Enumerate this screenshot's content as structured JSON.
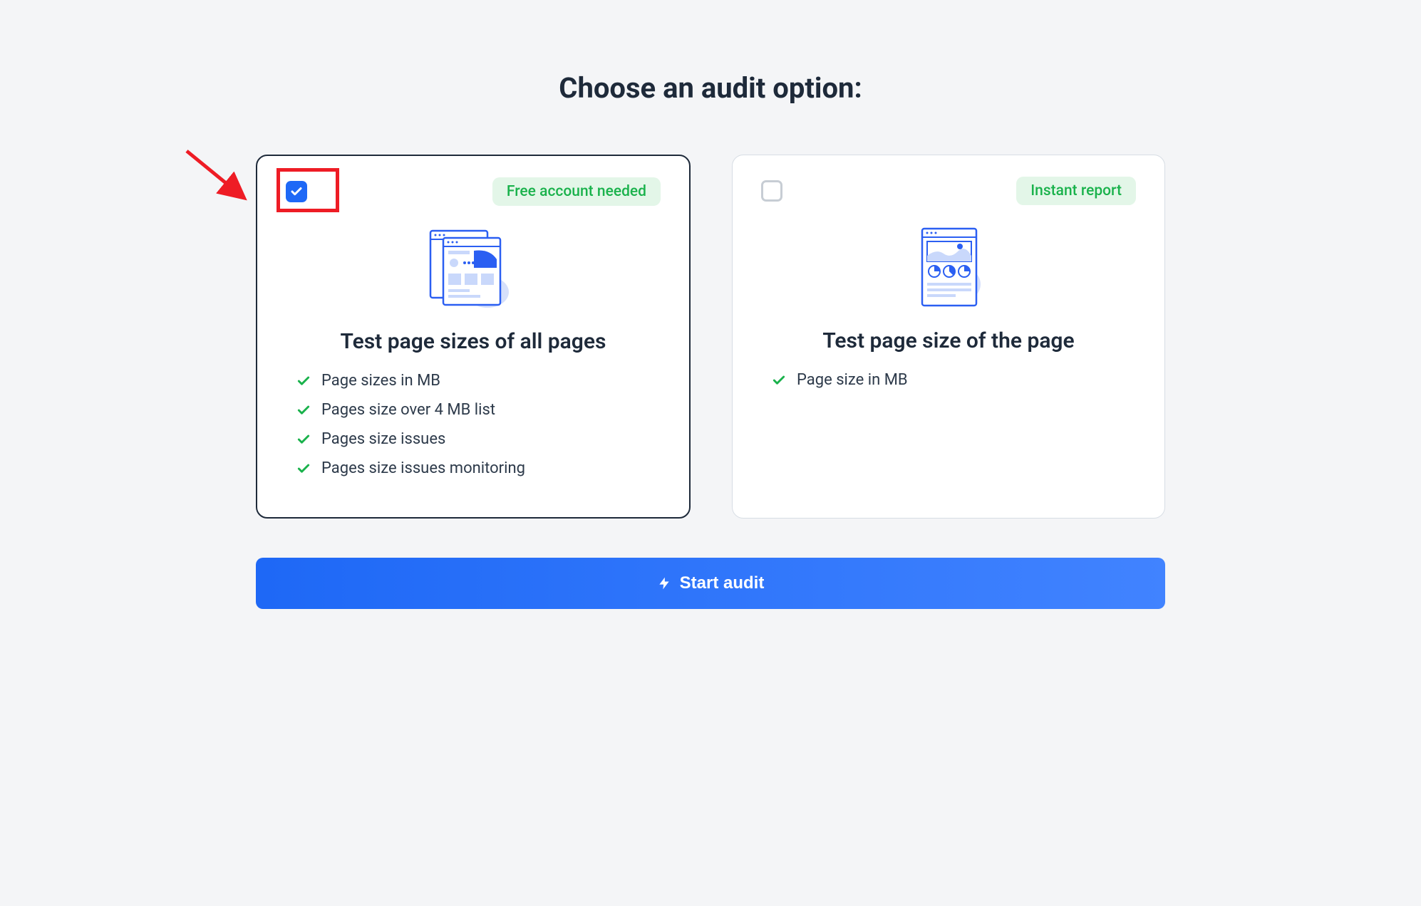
{
  "title": "Choose an audit option:",
  "cards": [
    {
      "selected": true,
      "badge": "Free account needed",
      "title": "Test page sizes of all pages",
      "features": [
        "Page sizes in MB",
        "Pages size over 4 MB list",
        "Pages size issues",
        "Pages size issues monitoring"
      ]
    },
    {
      "selected": false,
      "badge": "Instant report",
      "title": "Test page size of the page",
      "features": [
        "Page size in MB"
      ]
    }
  ],
  "button_label": "Start audit"
}
